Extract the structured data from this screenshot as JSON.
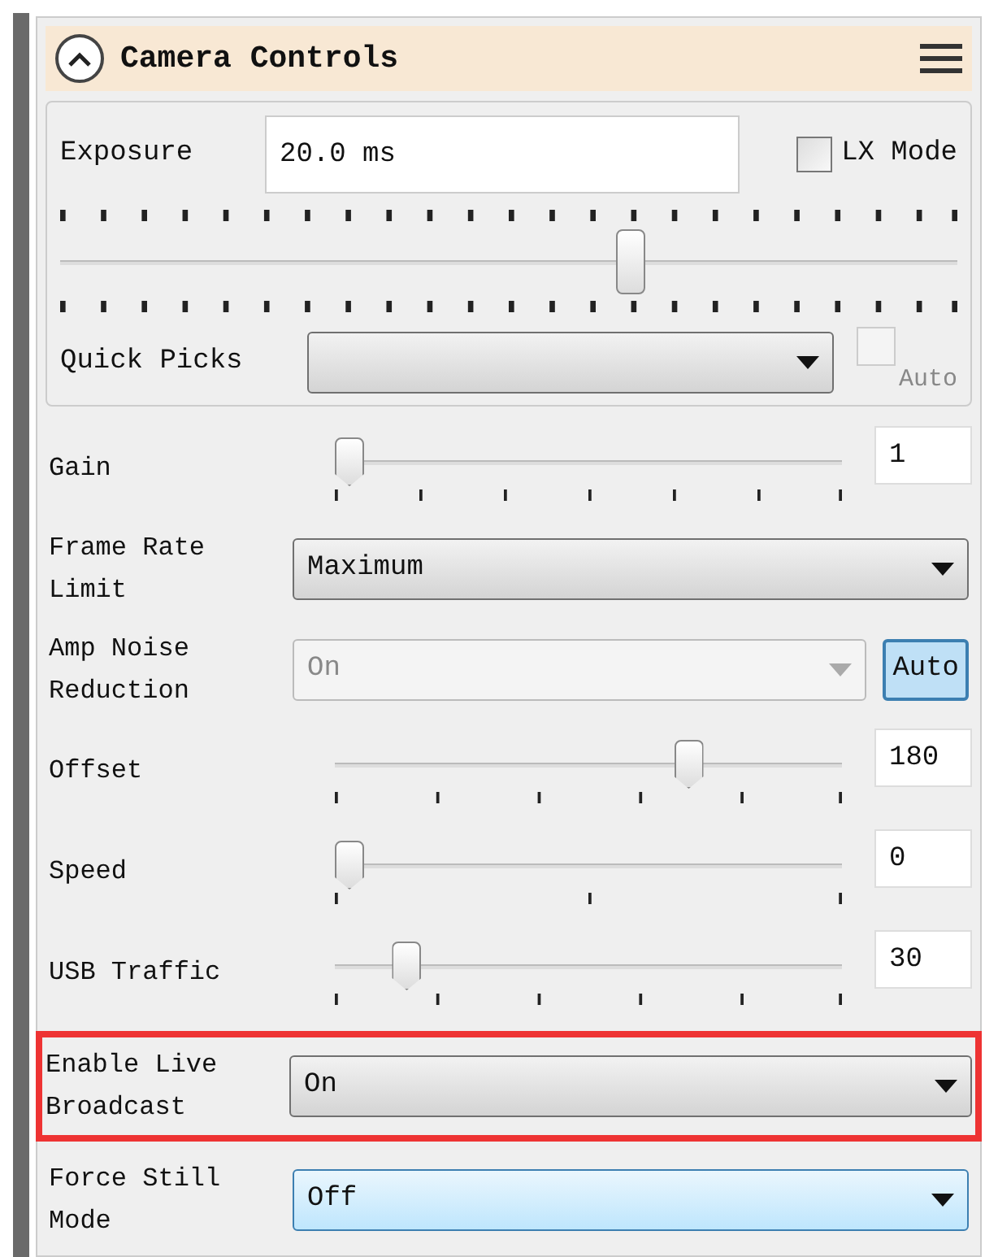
{
  "panel": {
    "title": "Camera Controls",
    "expanded": true
  },
  "exposure": {
    "label": "Exposure",
    "value": "20.0 ms",
    "lx_mode": {
      "label": "LX Mode",
      "checked": false
    },
    "level": 0.64,
    "quick_picks": {
      "label": "Quick Picks",
      "auto": {
        "label": "Auto",
        "checked": false,
        "disabled": true
      }
    }
  },
  "rows": [
    {
      "kind": "slider",
      "label": "Gain",
      "level": 0,
      "value": "1"
    },
    {
      "kind": "select",
      "label": "Frame Rate Limit",
      "value": "Maximum",
      "disabled": false,
      "focused": false,
      "highlighted": false
    },
    {
      "kind": "select",
      "label": "Amp Noise Reduction",
      "value": "On",
      "disabled": true,
      "focused": false,
      "highlighted": false,
      "auto": {
        "label": "Auto",
        "selected": true
      }
    },
    {
      "kind": "slider",
      "label": "Offset",
      "level": 0.71,
      "value": "180"
    },
    {
      "kind": "slider",
      "label": "Speed",
      "level": 0,
      "value": "0"
    },
    {
      "kind": "slider",
      "label": "USB Traffic",
      "level": 0.12,
      "value": "30"
    },
    {
      "kind": "select",
      "label": "Enable Live Broadcast",
      "value": "On",
      "disabled": false,
      "focused": false,
      "highlighted": true
    },
    {
      "kind": "select",
      "label": "Force Still Mode",
      "value": "Off",
      "disabled": false,
      "focused": true,
      "highlighted": false
    }
  ]
}
